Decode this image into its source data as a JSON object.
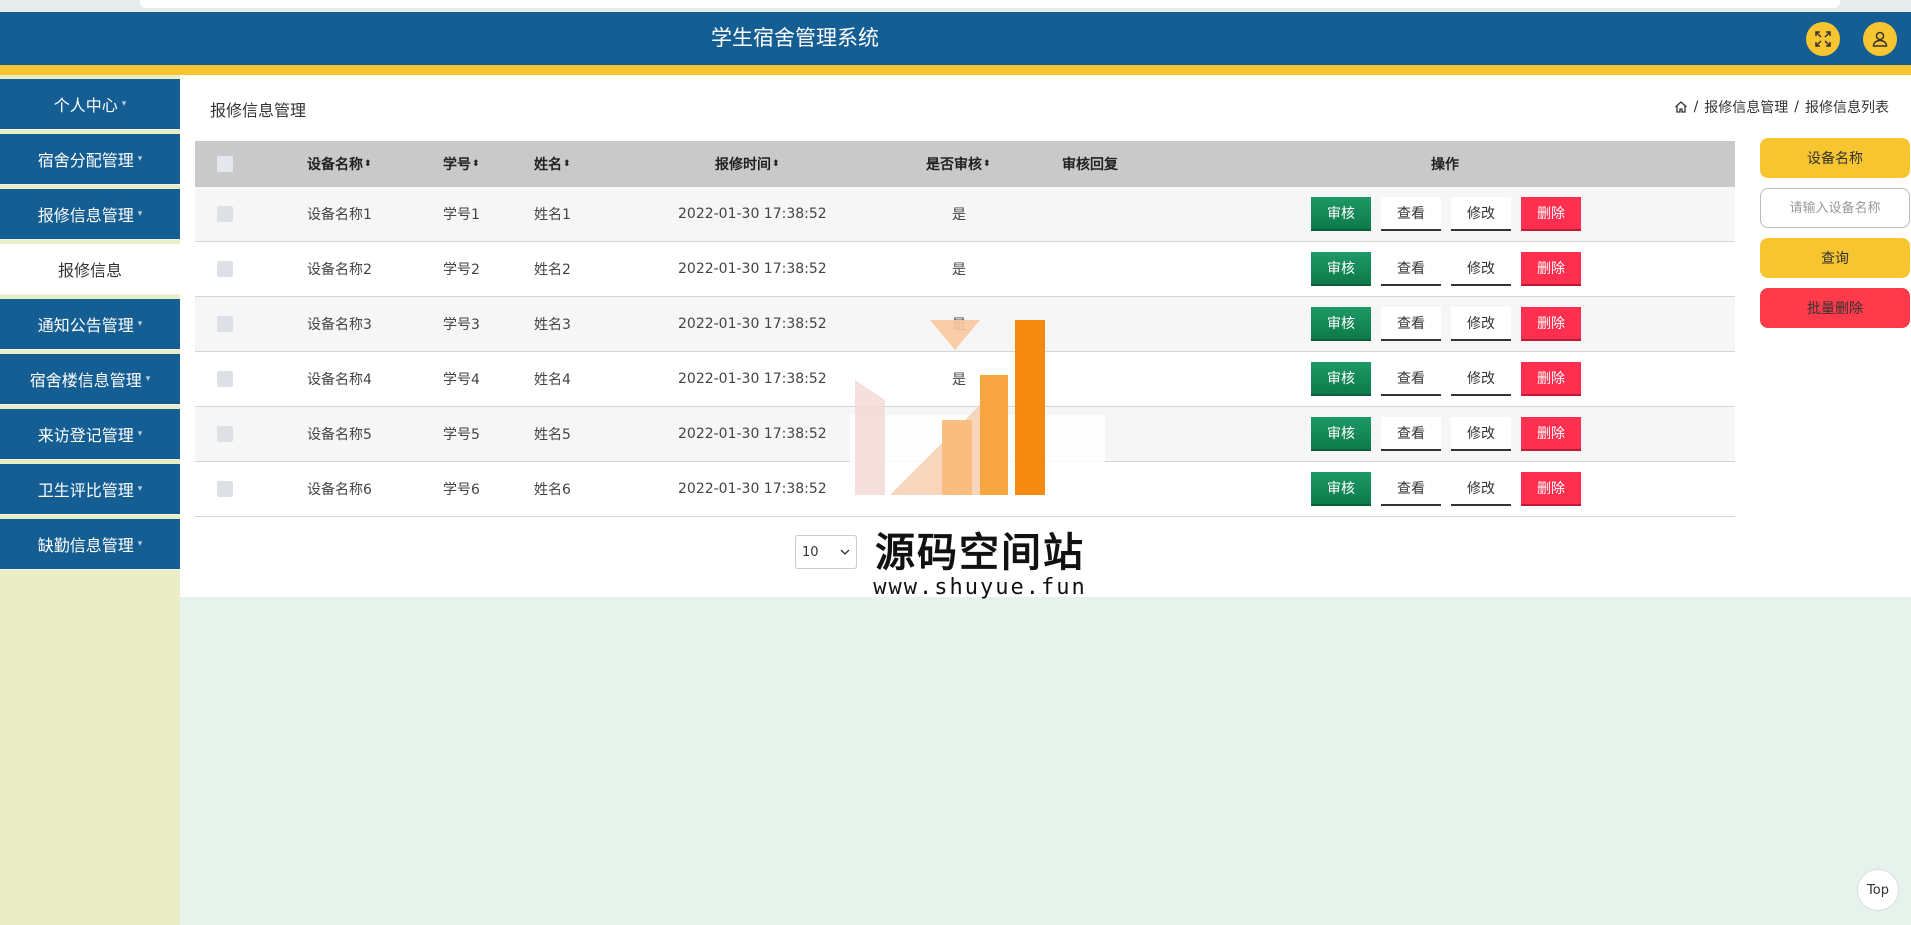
{
  "header": {
    "title": "学生宿舍管理系统"
  },
  "sidebar": {
    "items": [
      {
        "label": "个人中心",
        "arrow": "▾"
      },
      {
        "label": "宿舍分配管理",
        "arrow": "▾"
      },
      {
        "label": "报修信息管理",
        "arrow": "▾"
      },
      {
        "label": "报修信息",
        "arrow": ""
      },
      {
        "label": "通知公告管理",
        "arrow": "▾"
      },
      {
        "label": "宿舍楼信息管理",
        "arrow": "▾"
      },
      {
        "label": "来访登记管理",
        "arrow": "▾"
      },
      {
        "label": "卫生评比管理",
        "arrow": "▾"
      },
      {
        "label": "缺勤信息管理",
        "arrow": "▾"
      }
    ]
  },
  "page": {
    "title": "报修信息管理",
    "breadcrumb": [
      "报修信息管理",
      "报修信息列表"
    ],
    "breadcrumb_sep": "/"
  },
  "table": {
    "headers": {
      "name": "设备名称",
      "sno": "学号",
      "student": "姓名",
      "time": "报修时间",
      "audit": "是否审核",
      "reply": "审核回复",
      "ops": "操作"
    },
    "sort_glyph": "⬍",
    "rows": [
      {
        "name": "设备名称1",
        "sno": "学号1",
        "student": "姓名1",
        "time": "2022-01-30 17:38:52",
        "audit": "是",
        "reply": ""
      },
      {
        "name": "设备名称2",
        "sno": "学号2",
        "student": "姓名2",
        "time": "2022-01-30 17:38:52",
        "audit": "是",
        "reply": ""
      },
      {
        "name": "设备名称3",
        "sno": "学号3",
        "student": "姓名3",
        "time": "2022-01-30 17:38:52",
        "audit": "是",
        "reply": ""
      },
      {
        "name": "设备名称4",
        "sno": "学号4",
        "student": "姓名4",
        "time": "2022-01-30 17:38:52",
        "audit": "是",
        "reply": ""
      },
      {
        "name": "设备名称5",
        "sno": "学号5",
        "student": "姓名5",
        "time": "2022-01-30 17:38:52",
        "audit": "是",
        "reply": ""
      },
      {
        "name": "设备名称6",
        "sno": "学号6",
        "student": "姓名6",
        "time": "2022-01-30 17:38:52",
        "audit": "是",
        "reply": ""
      }
    ],
    "actions": {
      "audit": "审核",
      "view": "查看",
      "edit": "修改",
      "delete": "删除"
    }
  },
  "pager": {
    "page_size": "10"
  },
  "search": {
    "field_label": "设备名称",
    "placeholder": "请输入设备名称",
    "query_label": "查询",
    "batch_delete_label": "批量删除"
  },
  "watermark": {
    "cn": "源码空间站",
    "url": "www.shuyue.fun"
  },
  "back_to_top": "Top",
  "colors": {
    "header": "#145e93",
    "accent": "#f7c530",
    "audit": "#0e7a4a",
    "delete": "#ff2f4f",
    "sidebar_bg": "#eaeec4",
    "page_bg": "#e6f2ec"
  }
}
